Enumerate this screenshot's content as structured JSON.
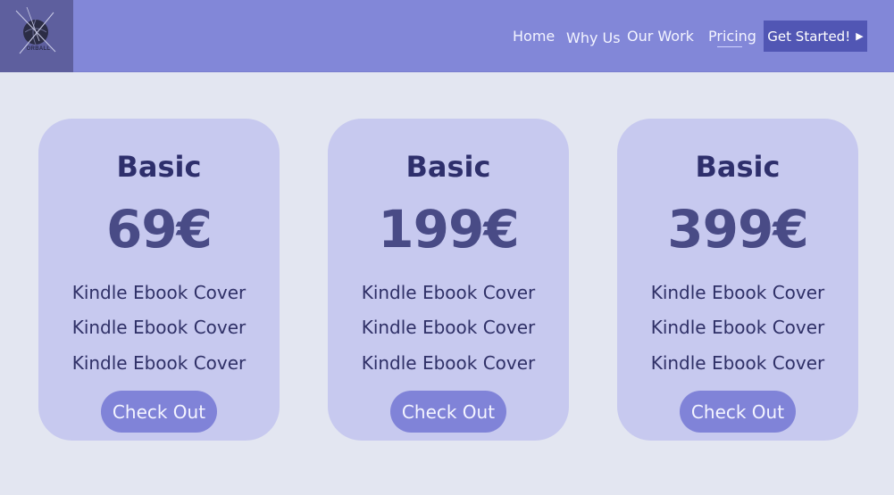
{
  "logo": {
    "text": "ORBALL"
  },
  "nav": {
    "items": [
      {
        "label": "Home"
      },
      {
        "label": "Why Us"
      },
      {
        "label": "Our Work"
      },
      {
        "label": "Pricing"
      }
    ],
    "cta_label": "Get Started!",
    "cta_icon": "play-arrow-icon"
  },
  "plans": [
    {
      "name": "Basic",
      "price": "69€",
      "features": [
        "Kindle Ebook Cover",
        "Kindle Ebook Cover",
        "Kindle Ebook Cover"
      ],
      "button": "Check Out"
    },
    {
      "name": "Basic",
      "price": "199€",
      "features": [
        "Kindle Ebook Cover",
        "Kindle Ebook Cover",
        "Kindle Ebook Cover"
      ],
      "button": "Check Out"
    },
    {
      "name": "Basic",
      "price": "399€",
      "features": [
        "Kindle Ebook Cover",
        "Kindle Ebook Cover",
        "Kindle Ebook Cover"
      ],
      "button": "Check Out"
    }
  ],
  "colors": {
    "header": "#8287d8",
    "background": "#e3e6f1",
    "card": "#c7c9ef",
    "button": "#8083d8",
    "cta": "#5156b4"
  }
}
